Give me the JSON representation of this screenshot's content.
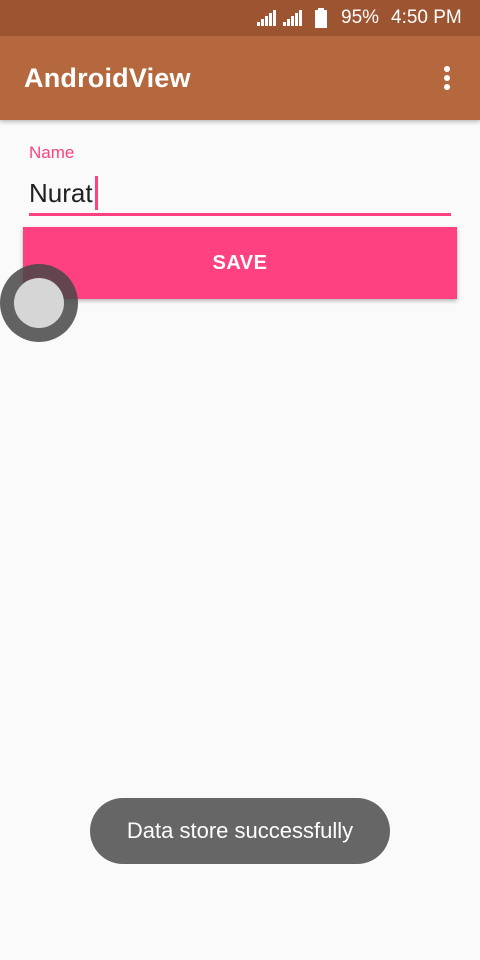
{
  "status_bar": {
    "battery_text": "95%",
    "clock": "4:50 PM",
    "icons": [
      "signal-icon",
      "signal-icon",
      "battery-icon"
    ]
  },
  "app_bar": {
    "title": "AndroidView",
    "menu_icon": "overflow-menu-icon",
    "color": "#b5683e",
    "status_color": "#9c5530"
  },
  "form": {
    "name_label": "Name",
    "name_value": "Nurat",
    "save_label": "SAVE",
    "accent_color": "#ff4081"
  },
  "toast": {
    "message": "Data store successfully"
  }
}
